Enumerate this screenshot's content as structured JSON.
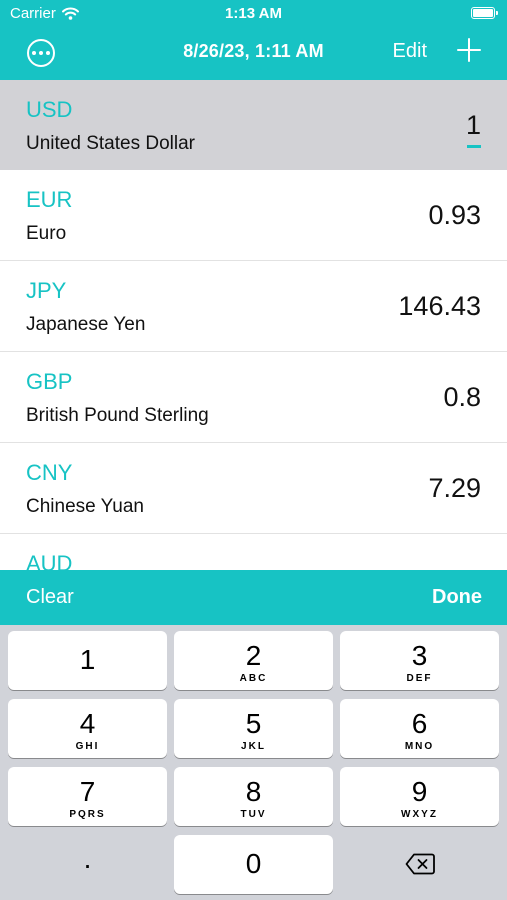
{
  "status_bar": {
    "carrier": "Carrier",
    "time": "1:13 AM"
  },
  "nav": {
    "title": "8/26/23, 1:11 AM",
    "edit_label": "Edit"
  },
  "currencies": [
    {
      "code": "USD",
      "name": "United States Dollar",
      "value": "1"
    },
    {
      "code": "EUR",
      "name": "Euro",
      "value": "0.93"
    },
    {
      "code": "JPY",
      "name": "Japanese Yen",
      "value": "146.43"
    },
    {
      "code": "GBP",
      "name": "British Pound Sterling",
      "value": "0.8"
    },
    {
      "code": "CNY",
      "name": "Chinese Yuan",
      "value": "7.29"
    },
    {
      "code": "AUD",
      "name": "",
      "value": ""
    }
  ],
  "accessory": {
    "clear_label": "Clear",
    "done_label": "Done"
  },
  "keypad": {
    "keys": [
      {
        "digit": "1",
        "letters": ""
      },
      {
        "digit": "2",
        "letters": "ABC"
      },
      {
        "digit": "3",
        "letters": "DEF"
      },
      {
        "digit": "4",
        "letters": "GHI"
      },
      {
        "digit": "5",
        "letters": "JKL"
      },
      {
        "digit": "6",
        "letters": "MNO"
      },
      {
        "digit": "7",
        "letters": "PQRS"
      },
      {
        "digit": "8",
        "letters": "TUV"
      },
      {
        "digit": "9",
        "letters": "WXYZ"
      }
    ],
    "decimal": ".",
    "zero": "0"
  },
  "icons": {
    "more": "ellipsis-circle-icon",
    "add": "plus-icon",
    "wifi": "wifi-icon",
    "battery": "battery-icon",
    "delete": "delete-backward-icon"
  },
  "colors": {
    "accent": "#17c3c4",
    "selected_row": "#d2d2d6",
    "keyboard_bg": "#d1d3d9"
  }
}
